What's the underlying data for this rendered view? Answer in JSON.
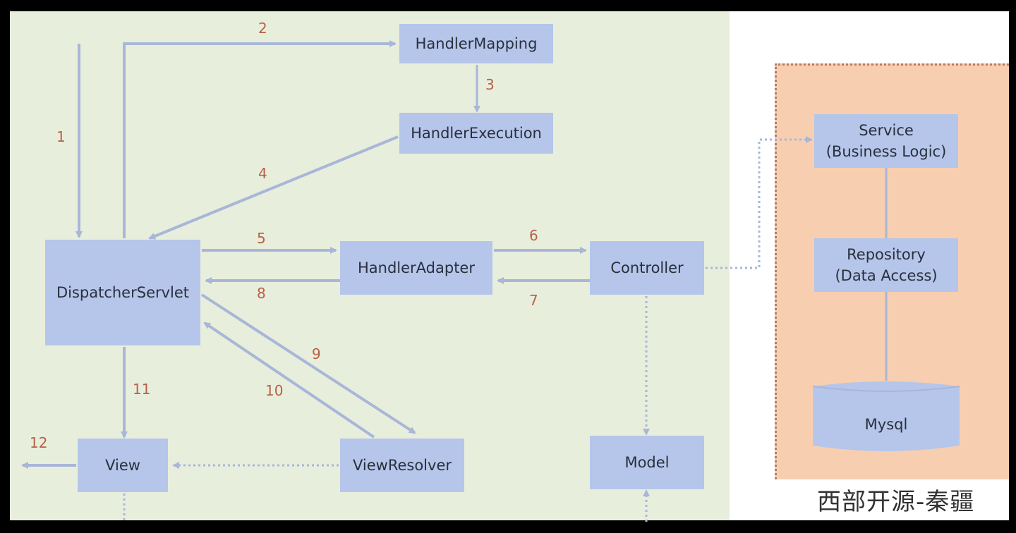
{
  "nodes": {
    "handler_mapping": "HandlerMapping",
    "handler_execution": "HandlerExecution",
    "dispatcher_servlet": "DispatcherServlet",
    "handler_adapter": "HandlerAdapter",
    "controller": "Controller",
    "view": "View",
    "view_resolver": "ViewResolver",
    "model": "Model",
    "service": "Service\n(Business Logic)",
    "repository": "Repository\n(Data Access)",
    "mysql": "Mysql"
  },
  "steps": [
    "1",
    "2",
    "3",
    "4",
    "5",
    "6",
    "7",
    "8",
    "9",
    "10",
    "11",
    "12"
  ],
  "watermark": "西部开源-秦疆",
  "colors": {
    "background": "#e8eedc",
    "node_fill": "#b5c6ea",
    "arrow": "#a9b6d8",
    "step_number": "#b86048",
    "business_panel": "#f7cfb0"
  }
}
